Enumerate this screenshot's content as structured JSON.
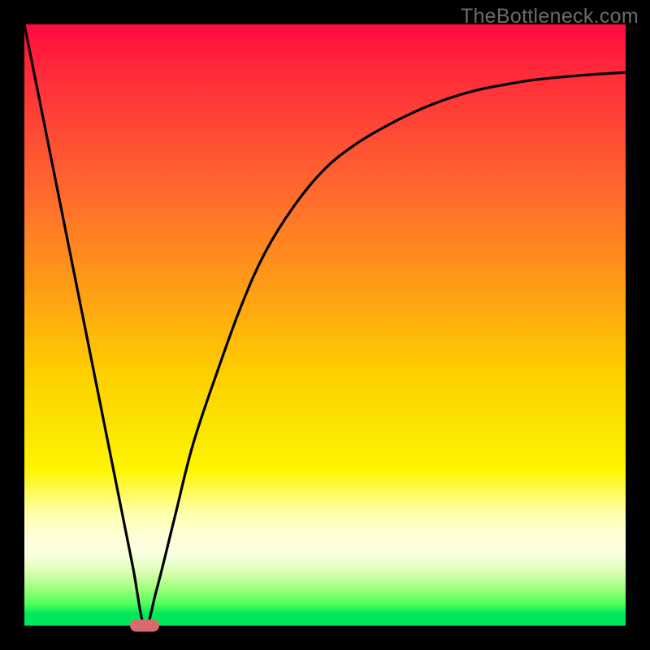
{
  "watermark": "TheBottleneck.com",
  "chart_data": {
    "type": "line",
    "title": "",
    "xlabel": "",
    "ylabel": "",
    "xlim": [
      0,
      100
    ],
    "ylim": [
      0,
      100
    ],
    "grid": false,
    "legend": false,
    "background_gradient": {
      "direction": "vertical",
      "stops": [
        {
          "pos": 0,
          "color": "#ff0b3f"
        },
        {
          "pos": 50,
          "color": "#ffc400"
        },
        {
          "pos": 78,
          "color": "#ffff30"
        },
        {
          "pos": 100,
          "color": "#00e85a"
        }
      ]
    },
    "series": [
      {
        "name": "bottleneck-curve",
        "x": [
          0,
          3,
          6,
          9,
          12,
          15,
          18,
          20,
          22,
          25,
          28,
          32,
          36,
          40,
          45,
          50,
          55,
          60,
          65,
          70,
          75,
          80,
          85,
          90,
          95,
          100
        ],
        "y": [
          100,
          85,
          70,
          55,
          40,
          25,
          10,
          0,
          6,
          18,
          30,
          42,
          53,
          62,
          70,
          76,
          80,
          83,
          85.5,
          87.5,
          89,
          90,
          90.8,
          91.3,
          91.7,
          92
        ]
      }
    ],
    "marker": {
      "x": 20,
      "y": 0,
      "color": "#d86a6f",
      "shape": "pill"
    }
  }
}
